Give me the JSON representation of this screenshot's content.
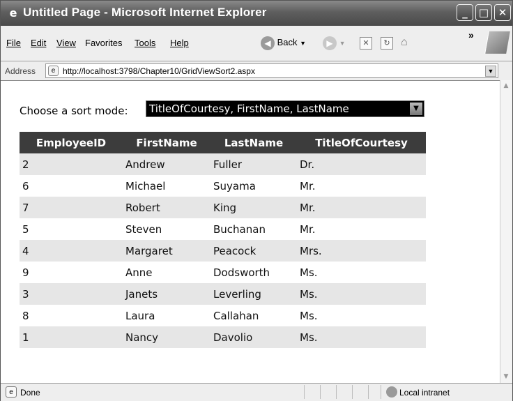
{
  "window": {
    "title": "Untitled Page - Microsoft Internet Explorer",
    "minimize": "_",
    "maximize": "□",
    "close": "✕"
  },
  "menu": {
    "items": [
      "File",
      "Edit",
      "View",
      "Favorites",
      "Tools",
      "Help"
    ],
    "back_label": "Back",
    "more": "»"
  },
  "address": {
    "label": "Address",
    "url": "http://localhost:3798/Chapter10/GridViewSort2.aspx"
  },
  "page": {
    "sort_label": "Choose a sort mode:",
    "sort_value": "TitleOfCourtesy, FirstName, LastName"
  },
  "grid": {
    "columns": [
      "EmployeeID",
      "FirstName",
      "LastName",
      "TitleOfCourtesy"
    ],
    "rows": [
      [
        "2",
        "Andrew",
        "Fuller",
        "Dr."
      ],
      [
        "6",
        "Michael",
        "Suyama",
        "Mr."
      ],
      [
        "7",
        "Robert",
        "King",
        "Mr."
      ],
      [
        "5",
        "Steven",
        "Buchanan",
        "Mr."
      ],
      [
        "4",
        "Margaret",
        "Peacock",
        "Mrs."
      ],
      [
        "9",
        "Anne",
        "Dodsworth",
        "Ms."
      ],
      [
        "3",
        "Janets",
        "Leverling",
        "Ms."
      ],
      [
        "8",
        "Laura",
        "Callahan",
        "Ms."
      ],
      [
        "1",
        "Nancy",
        "Davolio",
        "Ms."
      ]
    ]
  },
  "status": {
    "text": "Done",
    "zone": "Local intranet"
  },
  "colors": {
    "header_bg": "#3c3c3c",
    "alt_row_bg": "#e6e6e6"
  }
}
